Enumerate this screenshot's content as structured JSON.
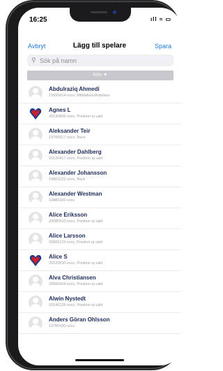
{
  "status": {
    "time": "16:25",
    "icons": "ıll ≈ ▭"
  },
  "nav": {
    "cancel": "Avbryt",
    "title": "Lägg till spelare",
    "save": "Spara"
  },
  "search": {
    "placeholder": "Sök på namn",
    "value": ""
  },
  "filter": {
    "label": "Kön ▼"
  },
  "players": [
    {
      "name": "Abdulraziq Ahmedi",
      "info": "19990414-xxxx, Mittfältare/Anfallare",
      "avatar": "person"
    },
    {
      "name": "Agnes L",
      "info": "20130806-xxxx, Position ej vald",
      "avatar": "crest"
    },
    {
      "name": "Aleksander Teir",
      "info": "19780517-xxxx, Back",
      "avatar": "person"
    },
    {
      "name": "Alexander Dahlberg",
      "info": "20120417-xxxx, Position ej vald",
      "avatar": "person"
    },
    {
      "name": "Alexander Johansson",
      "info": "19881023-xxxx, Back",
      "avatar": "person"
    },
    {
      "name": "Alexander Westman",
      "info": "19880320-xxxx",
      "avatar": "person"
    },
    {
      "name": "Alice Eriksson",
      "info": "20080910-xxxx, Position ej vald",
      "avatar": "person"
    },
    {
      "name": "Alice Larsson",
      "info": "20081123-xxxx, Position ej vald",
      "avatar": "person"
    },
    {
      "name": "Alice S",
      "info": "20120830-xxxx, Position ej vald",
      "avatar": "crest"
    },
    {
      "name": "Alva Christiansen",
      "info": "20080404-xxxx, Position ej vald",
      "avatar": "person"
    },
    {
      "name": "Alwin Nystedt",
      "info": "20140128-xxxx, Position ej vald",
      "avatar": "person"
    },
    {
      "name": "Anders Göran Ohlsson",
      "info": "19780430-xxxx",
      "avatar": "person"
    }
  ]
}
